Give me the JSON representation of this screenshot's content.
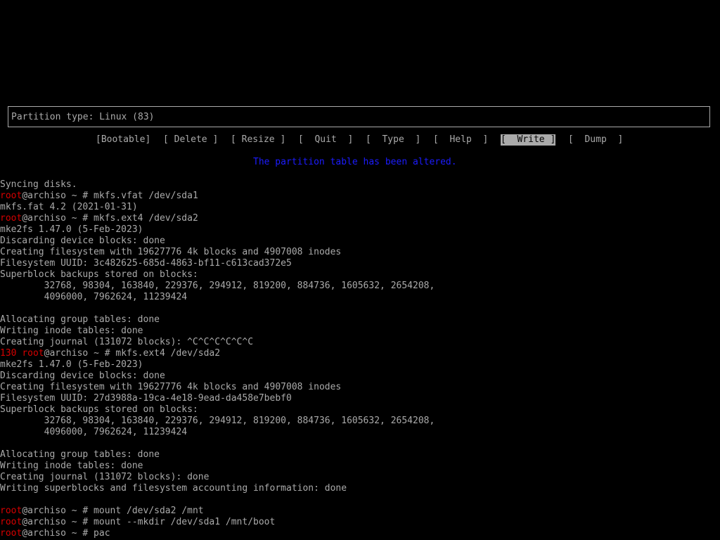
{
  "colors": {
    "background": "#000000",
    "text": "#aaaaaa",
    "prompt_user": "#d60000",
    "altered_message": "#1c1cff",
    "selected_bg": "#aaaaaa"
  },
  "cfdisk": {
    "partition_type": "Partition type: Linux (83)",
    "menu": [
      {
        "label": "[Bootable]",
        "selected": false
      },
      {
        "label": "[ Delete ]",
        "selected": false
      },
      {
        "label": "[ Resize ]",
        "selected": false
      },
      {
        "label": "[  Quit  ]",
        "selected": false
      },
      {
        "label": "[  Type  ]",
        "selected": false
      },
      {
        "label": "[  Help  ]",
        "selected": false
      },
      {
        "label": "[  Write ]",
        "selected": true
      },
      {
        "label": "[  Dump  ]",
        "selected": false
      }
    ],
    "status_message": "The partition table has been altered."
  },
  "terminal": {
    "lines": [
      {
        "text": "Syncing disks."
      },
      {
        "exit": "",
        "user": "root",
        "rest": "@archiso ~ # mkfs.vfat /dev/sda1"
      },
      {
        "text": "mkfs.fat 4.2 (2021-01-31)"
      },
      {
        "exit": "",
        "user": "root",
        "rest": "@archiso ~ # mkfs.ext4 /dev/sda2"
      },
      {
        "text": "mke2fs 1.47.0 (5-Feb-2023)"
      },
      {
        "text": "Discarding device blocks: done"
      },
      {
        "text": "Creating filesystem with 19627776 4k blocks and 4907008 inodes"
      },
      {
        "text": "Filesystem UUID: 3c482625-685d-4863-bf11-c613cad372e5"
      },
      {
        "text": "Superblock backups stored on blocks:"
      },
      {
        "text": "        32768, 98304, 163840, 229376, 294912, 819200, 884736, 1605632, 2654208,"
      },
      {
        "text": "        4096000, 7962624, 11239424"
      },
      {
        "text": ""
      },
      {
        "text": "Allocating group tables: done"
      },
      {
        "text": "Writing inode tables: done"
      },
      {
        "text": "Creating journal (131072 blocks): ^C^C^C^C^C^C"
      },
      {
        "exit": "130 ",
        "user": "root",
        "rest": "@archiso ~ # mkfs.ext4 /dev/sda2"
      },
      {
        "text": "mke2fs 1.47.0 (5-Feb-2023)"
      },
      {
        "text": "Discarding device blocks: done"
      },
      {
        "text": "Creating filesystem with 19627776 4k blocks and 4907008 inodes"
      },
      {
        "text": "Filesystem UUID: 27d3988a-19ca-4e18-9ead-da458e7bebf0"
      },
      {
        "text": "Superblock backups stored on blocks:"
      },
      {
        "text": "        32768, 98304, 163840, 229376, 294912, 819200, 884736, 1605632, 2654208,"
      },
      {
        "text": "        4096000, 7962624, 11239424"
      },
      {
        "text": ""
      },
      {
        "text": "Allocating group tables: done"
      },
      {
        "text": "Writing inode tables: done"
      },
      {
        "text": "Creating journal (131072 blocks): done"
      },
      {
        "text": "Writing superblocks and filesystem accounting information: done"
      },
      {
        "text": ""
      },
      {
        "exit": "",
        "user": "root",
        "rest": "@archiso ~ # mount /dev/sda2 /mnt"
      },
      {
        "exit": "",
        "user": "root",
        "rest": "@archiso ~ # mount --mkdir /dev/sda1 /mnt/boot"
      },
      {
        "exit": "",
        "user": "root",
        "rest": "@archiso ~ # pac"
      }
    ]
  }
}
